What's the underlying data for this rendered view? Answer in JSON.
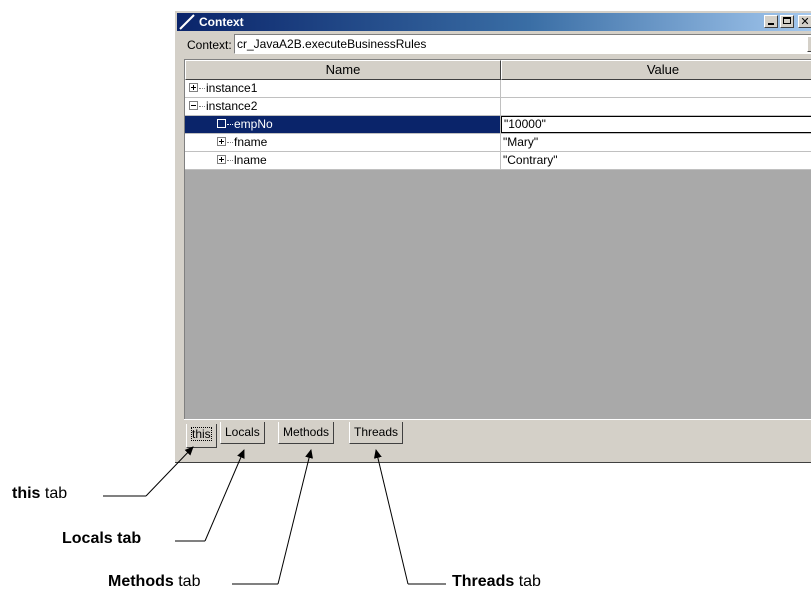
{
  "window": {
    "title": "Context",
    "context_label": "Context:",
    "context_value": "cr_JavaA2B.executeBusinessRules"
  },
  "table": {
    "columns": [
      "Name",
      "Value"
    ],
    "rows": [
      {
        "name": "instance1",
        "value": "",
        "expander": "plus",
        "level": 0,
        "selected": false
      },
      {
        "name": "instance2",
        "value": "",
        "expander": "minus",
        "level": 0,
        "selected": false
      },
      {
        "name": "empNo",
        "value": "\"10000\"",
        "expander": "leaf",
        "level": 1,
        "selected": true
      },
      {
        "name": "fname",
        "value": "\"Mary\"",
        "expander": "plus",
        "level": 1,
        "selected": false
      },
      {
        "name": "lname",
        "value": "\"Contrary\"",
        "expander": "plus",
        "level": 1,
        "selected": false
      }
    ]
  },
  "tabs": [
    "this",
    "Locals",
    "Methods",
    "Threads"
  ],
  "active_tab": "this",
  "callouts": {
    "this": {
      "bold": "this",
      "rest": " tab"
    },
    "locals": {
      "bold": "Locals tab",
      "rest": ""
    },
    "methods": {
      "bold": "Methods",
      "rest": " tab"
    },
    "threads": {
      "bold": "Threads",
      "rest": " tab"
    }
  },
  "colors": {
    "selection": "#0a246a",
    "titlebar_start": "#0a246a",
    "titlebar_end": "#a6caf0",
    "face": "#d4d0c8"
  }
}
